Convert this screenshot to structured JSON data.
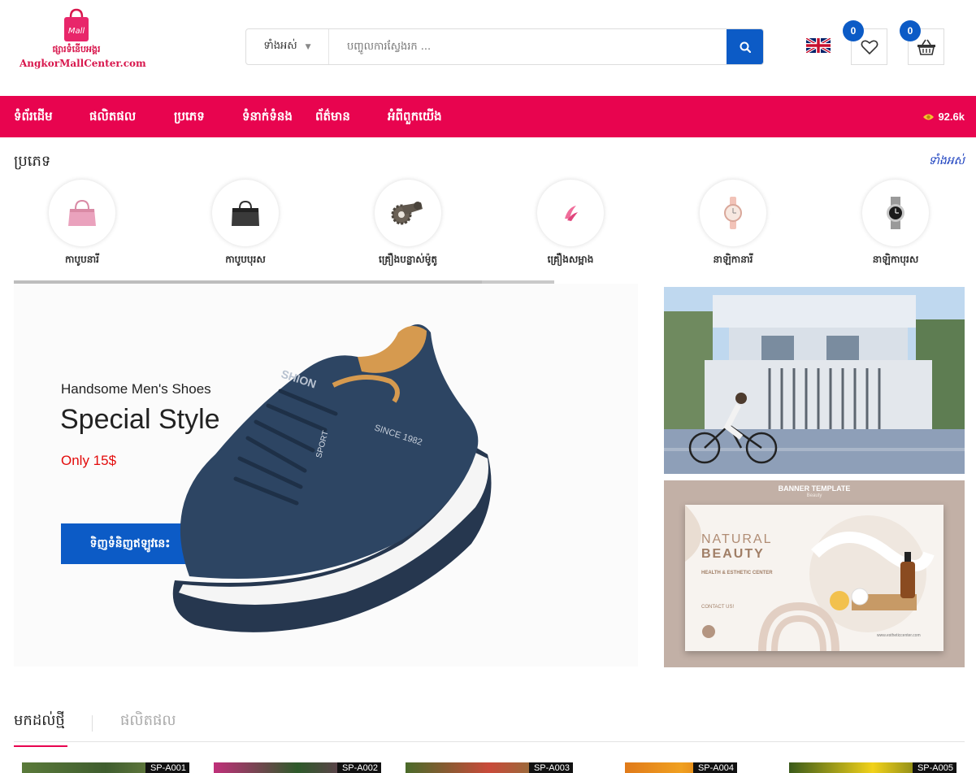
{
  "header": {
    "logo": {
      "bag_text": "Mall",
      "khmer": "ផ្សារទំនើបអង្គរ",
      "english": "AngkorMallCenter.com"
    },
    "search": {
      "category": "ទាំងអស់",
      "placeholder": "បញ្ចូលការស្វែងរក ..."
    },
    "language_icon": "uk-flag-icon",
    "wishlist_count": "0",
    "cart_count": "0"
  },
  "nav": {
    "items": [
      "ទំព័រដើម",
      "ផលិតផល",
      "ប្រភេទ",
      "ទំនាក់ទំនង",
      "ព័ត៌មាន",
      "អំពីពួកយើង"
    ],
    "views": "92.6k"
  },
  "categories": {
    "title": "ប្រភេទ",
    "view_all": "ទាំងអស់",
    "items": [
      {
        "label": "កាបូបនារី",
        "icon": "pink-handbag-icon"
      },
      {
        "label": "កាបូបបុរស",
        "icon": "black-briefcase-icon"
      },
      {
        "label": "គ្រឿងបន្លាស់ម៉ូតូ",
        "icon": "motor-sprocket-icon"
      },
      {
        "label": "គ្រឿងសម្អាង",
        "icon": "cosmetics-icon"
      },
      {
        "label": "នាឡិកានារី",
        "icon": "women-watch-icon"
      },
      {
        "label": "នាឡិកាបុរស",
        "icon": "men-watch-icon"
      }
    ]
  },
  "hero": {
    "subtitle": "Handsome Men's Shoes",
    "title": "Special Style",
    "price": "Only 15$",
    "button": "ទិញទំនិញឥឡូវនេះ",
    "shoe_text": "SINCE 1982",
    "shoe_tongue": "SPORT",
    "shoe_brand": "SHION",
    "slider_progress": 0.866
  },
  "banners": {
    "beauty": {
      "top": "BANNER TEMPLATE",
      "top_sub": "Beauty",
      "natural": "NATURAL",
      "beauty": "BEAUTY",
      "health": "HEALTH & ESTHETIC CENTER",
      "contact": "CONTACT US!",
      "url": "www.estheticcenter.com"
    }
  },
  "tabs": {
    "active": "មកដល់ថ្មី",
    "inactive": "ផលិតផល"
  },
  "products": [
    {
      "sku": "SP-A001"
    },
    {
      "sku": "SP-A002"
    },
    {
      "sku": "SP-A003"
    },
    {
      "sku": "SP-A004"
    },
    {
      "sku": "SP-A005"
    }
  ],
  "colors": {
    "brand_pink": "#e8044f",
    "brand_blue": "#0c5bc6",
    "price_red": "#e30b0b"
  }
}
